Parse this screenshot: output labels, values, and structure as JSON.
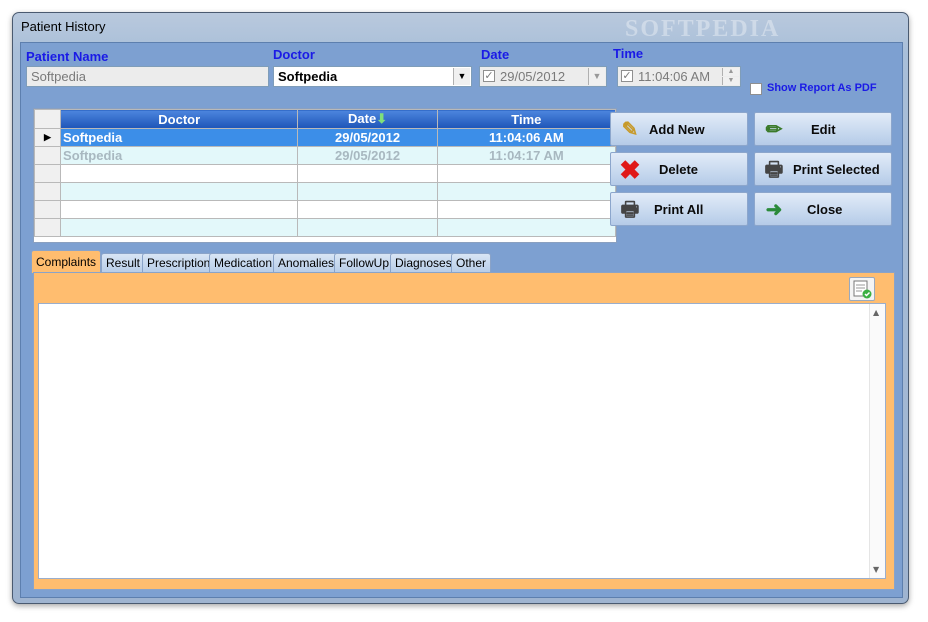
{
  "window": {
    "title": "Patient History",
    "watermark": "SOFTPEDIA"
  },
  "form": {
    "patient_name_label": "Patient Name",
    "patient_name_value": "Softpedia",
    "doctor_label": "Doctor",
    "doctor_value": "Softpedia",
    "date_label": "Date",
    "date_value": "29/05/2012",
    "time_label": "Time",
    "time_value": "11:04:06 AM",
    "show_pdf_label": "Show Report As PDF"
  },
  "grid": {
    "columns": [
      "Doctor",
      "Date",
      "Time"
    ],
    "rows": [
      {
        "doctor": "Softpedia",
        "date": "29/05/2012",
        "time": "11:04:06 AM"
      },
      {
        "doctor": "Softpedia",
        "date": "29/05/2012",
        "time": "11:04:17 AM"
      }
    ]
  },
  "buttons": {
    "add_new": "Add New",
    "edit": "Edit",
    "delete": "Delete",
    "print_selected": "Print Selected",
    "print_all": "Print All",
    "close": "Close"
  },
  "tabs": [
    "Complaints",
    "Result",
    "Prescription",
    "Medication",
    "Anomalies",
    "FollowUp",
    "Diagnoses",
    "Other"
  ],
  "icons": {
    "add_new": "add-icon",
    "edit": "edit-icon",
    "delete": "delete-icon",
    "print": "printer-icon",
    "close": "exit-door-icon",
    "sort": "sort-down-arrow-icon",
    "report": "document-check-icon"
  },
  "colors": {
    "accent_tab": "#ffbd6f",
    "header_blue": "#1d55b8",
    "label_blue": "#1a1ae6",
    "selected_row": "#3c8ee8"
  }
}
